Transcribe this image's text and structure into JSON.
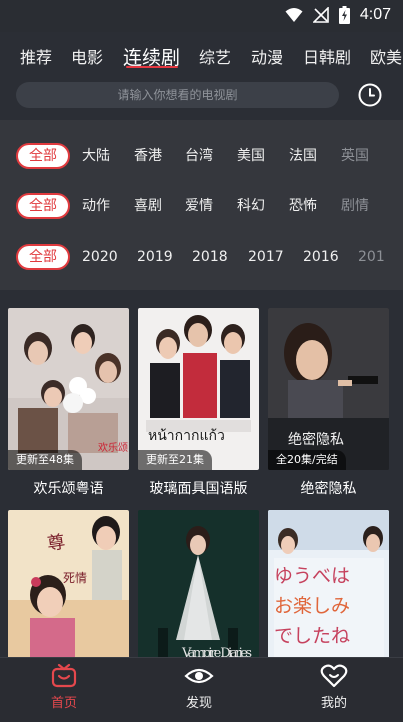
{
  "status": {
    "time": "4:07"
  },
  "tabs": [
    {
      "label": "推荐"
    },
    {
      "label": "电影"
    },
    {
      "label": "连续剧"
    },
    {
      "label": "综艺"
    },
    {
      "label": "动漫"
    },
    {
      "label": "日韩剧"
    },
    {
      "label": "欧美"
    }
  ],
  "search": {
    "placeholder": "请输入你想看的电视剧"
  },
  "filters": {
    "region": {
      "all": "全部",
      "items": [
        "大陆",
        "香港",
        "台湾",
        "美国",
        "法国",
        "英国"
      ]
    },
    "genre": {
      "all": "全部",
      "items": [
        "动作",
        "喜剧",
        "爱情",
        "科幻",
        "恐怖",
        "剧情"
      ]
    },
    "year": {
      "all": "全部",
      "items": [
        "2020",
        "2019",
        "2018",
        "2017",
        "2016",
        "201"
      ]
    }
  },
  "cards": [
    {
      "title": "欢乐颂粤语",
      "badge": "更新至48集"
    },
    {
      "title": "玻璃面具国语版",
      "badge": "更新至21集"
    },
    {
      "title": "绝密隐私",
      "badge": "全20集/完结"
    },
    {
      "title": "",
      "badge": ""
    },
    {
      "title": "",
      "badge": ""
    },
    {
      "title": "",
      "badge": ""
    }
  ],
  "poster_text": {
    "p2_thai": "หน้ากากแก้ว",
    "p3_cn": "绝密隐私",
    "p5_en": "Vampire Diaries",
    "p6_jp": "ゆうべは お楽しみ でしたね"
  },
  "nav": [
    {
      "label": "首页",
      "icon": "tv-icon"
    },
    {
      "label": "发现",
      "icon": "eye-icon"
    },
    {
      "label": "我的",
      "icon": "heart-face-icon"
    }
  ],
  "colors": {
    "accent": "#e5484d",
    "background": "#2b2e35",
    "panel": "#35373d"
  }
}
